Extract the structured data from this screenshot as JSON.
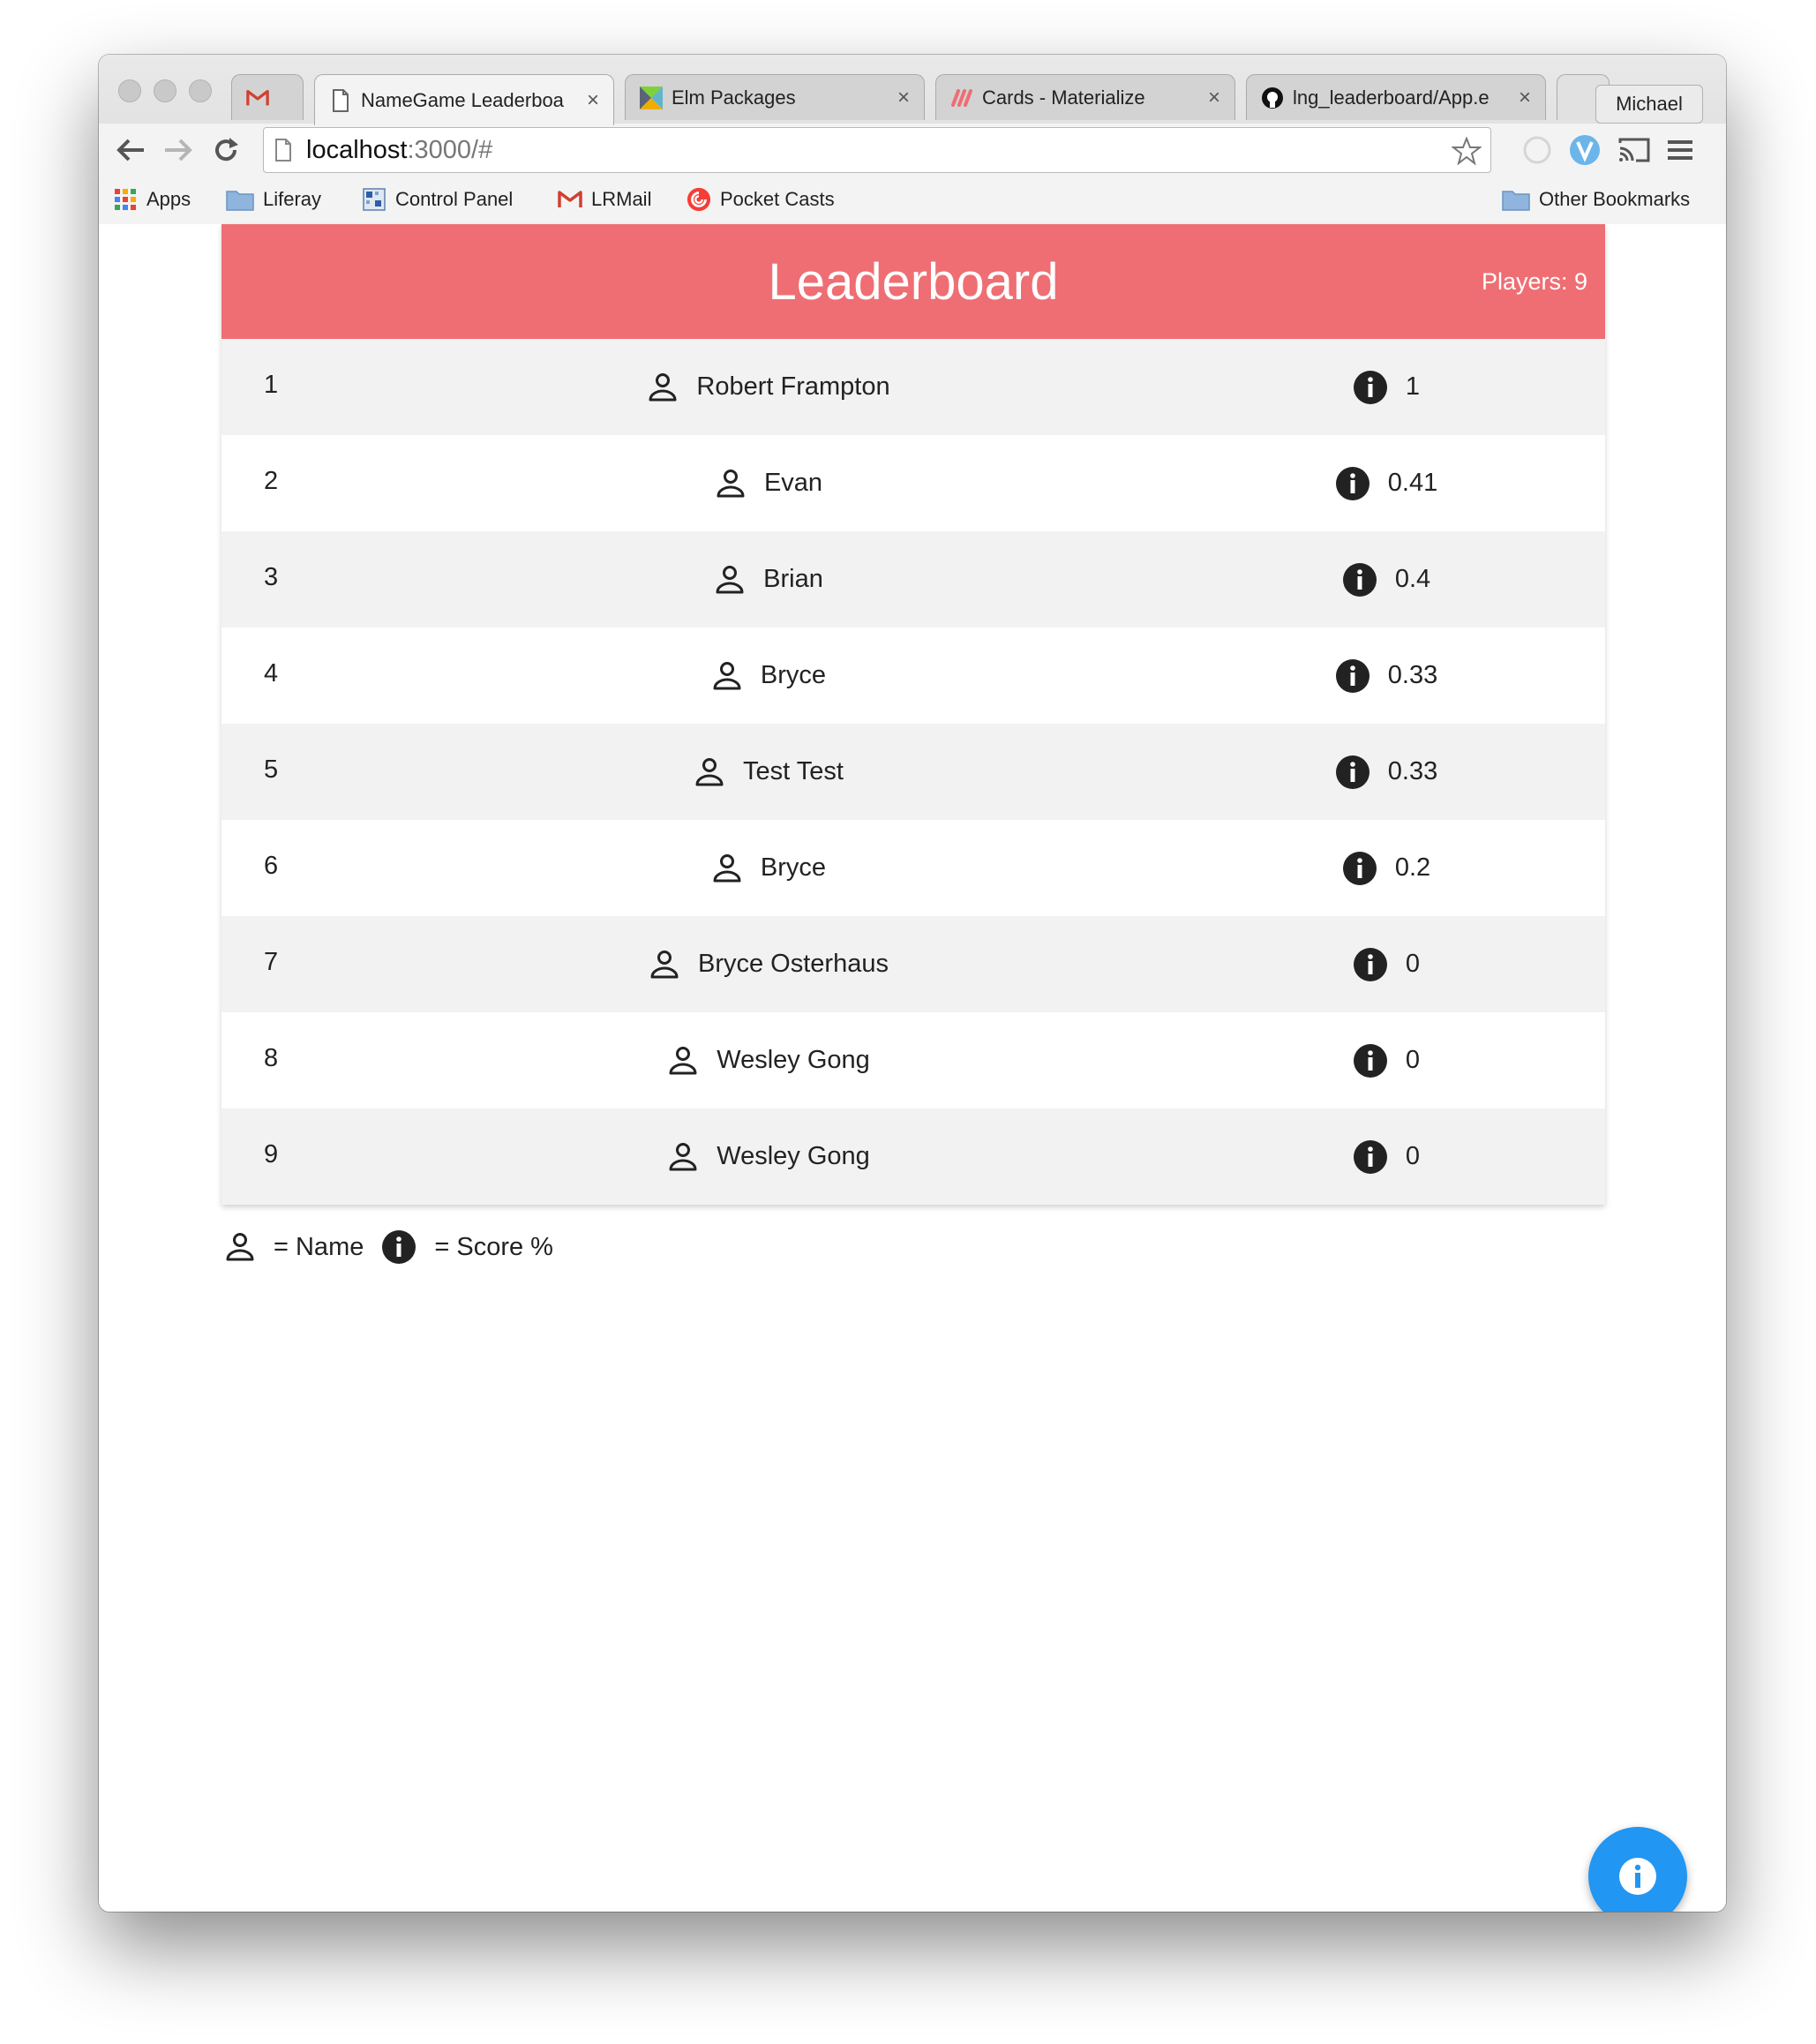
{
  "browser": {
    "tabs": [
      {
        "label": "",
        "icon": "gmail-icon"
      },
      {
        "label": "NameGame Leaderboa",
        "icon": "page-icon",
        "active": true
      },
      {
        "label": "Elm Packages",
        "icon": "elm-icon"
      },
      {
        "label": "Cards - Materialize",
        "icon": "materialize-icon"
      },
      {
        "label": "lng_leaderboard/App.e",
        "icon": "github-icon"
      }
    ],
    "tab_close_glyph": "×",
    "profile_name": "Michael",
    "address": {
      "host": "localhost",
      "rest": ":3000/#"
    },
    "bookmarks": [
      {
        "label": "Apps",
        "icon": "apps-grid-icon"
      },
      {
        "label": "Liferay",
        "icon": "folder-icon"
      },
      {
        "label": "Control Panel",
        "icon": "control-panel-icon"
      },
      {
        "label": "LRMail",
        "icon": "gmail-icon"
      },
      {
        "label": "Pocket Casts",
        "icon": "pocket-casts-icon"
      }
    ],
    "other_bookmarks": "Other Bookmarks"
  },
  "leaderboard": {
    "title": "Leaderboard",
    "players_label": "Players: 9",
    "rows": [
      {
        "rank": "1",
        "name": "Robert Frampton",
        "score": "1"
      },
      {
        "rank": "2",
        "name": "Evan",
        "score": "0.41"
      },
      {
        "rank": "3",
        "name": "Brian",
        "score": "0.4"
      },
      {
        "rank": "4",
        "name": "Bryce",
        "score": "0.33"
      },
      {
        "rank": "5",
        "name": "Test Test",
        "score": "0.33"
      },
      {
        "rank": "6",
        "name": "Bryce",
        "score": "0.2"
      },
      {
        "rank": "7",
        "name": "Bryce Osterhaus",
        "score": "0"
      },
      {
        "rank": "8",
        "name": "Wesley Gong",
        "score": "0"
      },
      {
        "rank": "9",
        "name": "Wesley Gong",
        "score": "0"
      }
    ]
  },
  "legend": {
    "name_label": "= Name",
    "score_label": "= Score %"
  },
  "colors": {
    "header": "#ef6e73",
    "row_odd": "#f2f2f2",
    "row_even": "#ffffff",
    "fab": "#2196f3"
  }
}
